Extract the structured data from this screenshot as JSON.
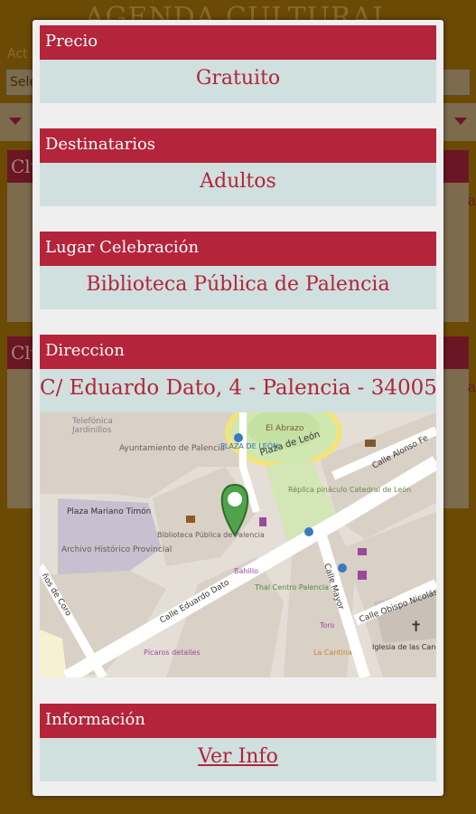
{
  "background": {
    "title": "AGENDA CULTURAL",
    "filter_label": "Act",
    "select_value": "Sele",
    "card1_header": "Clu",
    "card2_header": "Clu",
    "card_edge_char": "a"
  },
  "modal": {
    "precio": {
      "label": "Precio",
      "value": "Gratuito"
    },
    "destinatarios": {
      "label": "Destinatarios",
      "value": "Adultos"
    },
    "lugar": {
      "label": "Lugar Celebración",
      "value": "Biblioteca Pública de Palencia"
    },
    "direccion": {
      "label": "Direccion",
      "value": "C/ Eduardo Dato, 4 - Palencia - 34005"
    },
    "informacion": {
      "label": "Información",
      "link": "Ver Info"
    }
  },
  "map": {
    "labels": {
      "jardinillos": "Jardinillos",
      "telefonica": "Telefónica",
      "ayuntamiento": "Ayuntamiento de Palencia",
      "plaza_mariano": "Plaza Mariano Timón",
      "archivo": "Archivo Histórico Provincial",
      "biblioteca": "Biblioteca Pública de Palencia",
      "plaza_leon_stop": "PLAZA DE LEÓN",
      "el_abrazo": "El Abrazo",
      "plaza_leon": "Plaza de León",
      "replica": "Réplica pináculo Catedral de León",
      "calle_alonso": "Calle Alonso Fe",
      "calle_mayor": "Calle Mayor",
      "calle_eduardo": "Calle Eduardo Dato",
      "calle_coro": "ños de Coro",
      "bahillo": "Bahillo",
      "thai": "Thai Centro Palencia",
      "picaros": "Pícaros detalles",
      "toro": "Toro",
      "la_cantina": "La Cantina",
      "iglesia": "Iglesia de las Canónigas",
      "calle_obispo": "Calle Obispo Nicolás"
    },
    "marker_icon": "map-pin-hand-icon"
  },
  "colors": {
    "header_red": "#b4243a",
    "value_bg": "#cfe0df",
    "modal_bg": "#efefef",
    "overlay": "#6b4a06"
  }
}
